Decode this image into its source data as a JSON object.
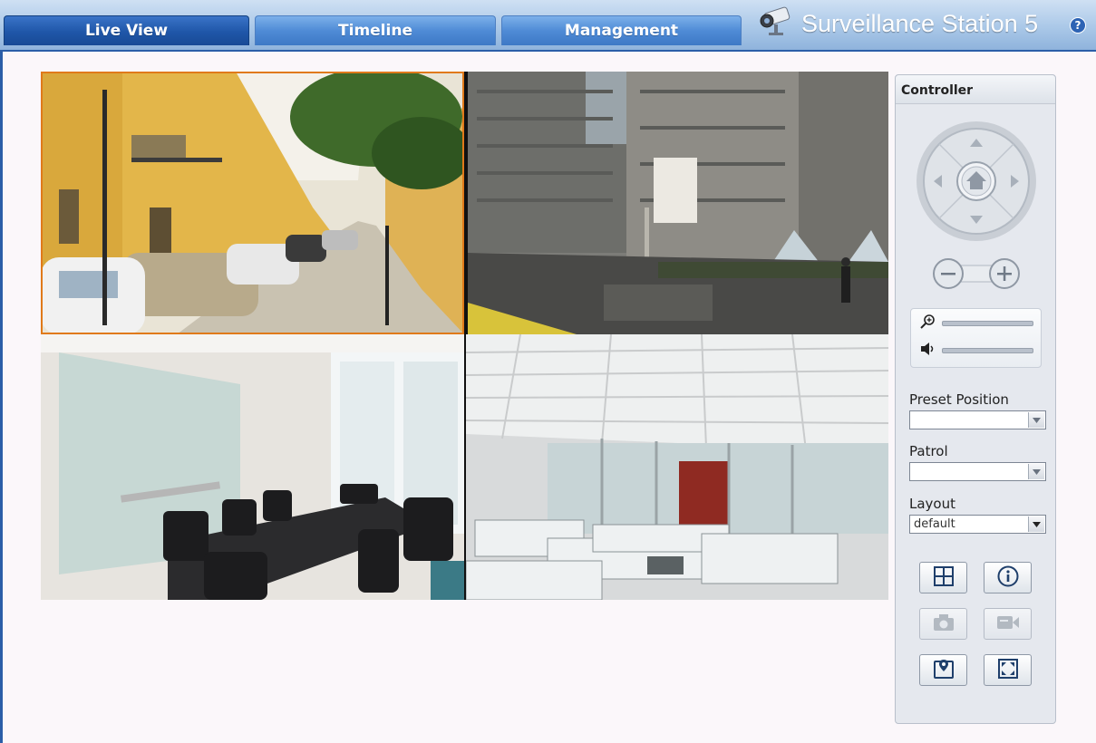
{
  "tabs": [
    {
      "label": "Live View",
      "active": true
    },
    {
      "label": "Timeline",
      "active": false
    },
    {
      "label": "Management",
      "active": false
    }
  ],
  "brand": {
    "title": "Surveillance Station 5",
    "icon": "cctv-camera-icon"
  },
  "help_label": "?",
  "cameras": [
    {
      "scene": "street-alley",
      "selected": true
    },
    {
      "scene": "city-plaza",
      "selected": false
    },
    {
      "scene": "meeting-room",
      "selected": false
    },
    {
      "scene": "office-cubicles",
      "selected": false
    }
  ],
  "controller": {
    "title": "Controller",
    "preset_label": "Preset Position",
    "preset_value": "",
    "patrol_label": "Patrol",
    "patrol_value": "",
    "layout_label": "Layout",
    "layout_value": "default",
    "buttons": [
      {
        "name": "layout-grid-button",
        "icon": "grid-icon",
        "enabled": true
      },
      {
        "name": "info-button",
        "icon": "info-icon",
        "enabled": true
      },
      {
        "name": "snapshot-button",
        "icon": "camera-icon",
        "enabled": false
      },
      {
        "name": "record-button",
        "icon": "video-icon",
        "enabled": false
      },
      {
        "name": "emap-button",
        "icon": "map-pin-icon",
        "enabled": true
      },
      {
        "name": "fullscreen-button",
        "icon": "fullscreen-icon",
        "enabled": true
      }
    ]
  },
  "colors": {
    "accent": "#1f56a8",
    "selection": "#e07a1a",
    "tab": "#4f8bd6"
  }
}
